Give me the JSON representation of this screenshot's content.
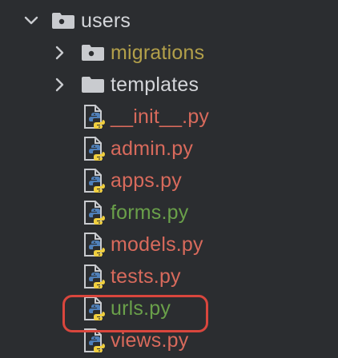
{
  "colors": {
    "background": "#2b2d30",
    "folder_default": "#d4d6da",
    "folder_excluded": "#b3a04a",
    "file_modified": "#d86a5c",
    "file_added": "#6aa04a",
    "highlight_ring": "#d9463d",
    "icon_gray": "#c9cbcf",
    "python_blue": "#4f7fb8",
    "python_yellow": "#f0cf3f"
  },
  "tree": {
    "root": {
      "label": "users",
      "icon": "folder-icon",
      "state": "expanded",
      "children": [
        {
          "label": "migrations",
          "icon": "folder-icon",
          "state": "collapsed"
        },
        {
          "label": "templates",
          "icon": "folder-icon",
          "state": "collapsed"
        },
        {
          "label": "__init__.py",
          "icon": "python-file-icon"
        },
        {
          "label": "admin.py",
          "icon": "python-file-icon"
        },
        {
          "label": "apps.py",
          "icon": "python-file-icon"
        },
        {
          "label": "forms.py",
          "icon": "python-file-icon"
        },
        {
          "label": "models.py",
          "icon": "python-file-icon"
        },
        {
          "label": "tests.py",
          "icon": "python-file-icon"
        },
        {
          "label": "urls.py",
          "icon": "python-file-icon",
          "highlighted": true
        },
        {
          "label": "views.py",
          "icon": "python-file-icon"
        }
      ]
    }
  }
}
